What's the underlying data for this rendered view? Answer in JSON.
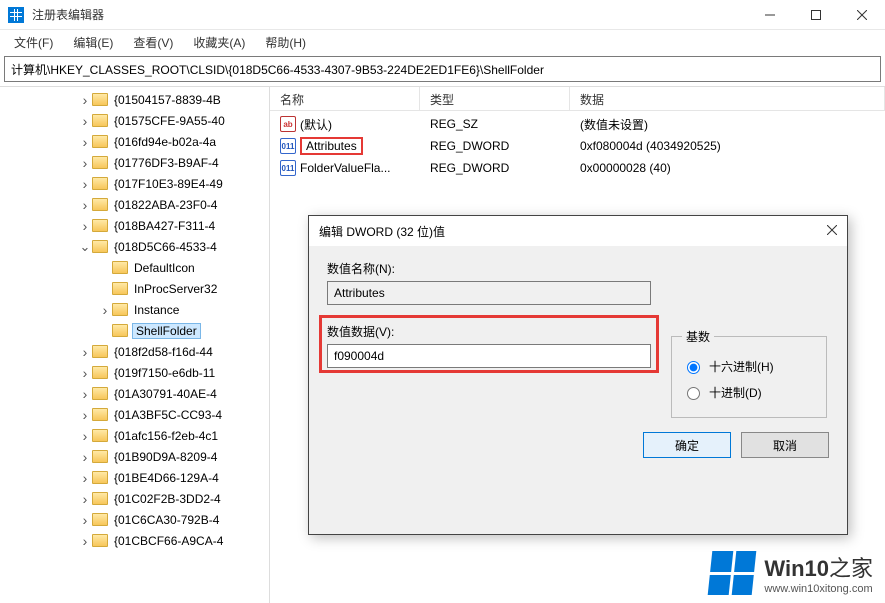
{
  "window": {
    "title": "注册表编辑器"
  },
  "menu": {
    "file": "文件(F)",
    "edit": "编辑(E)",
    "view": "查看(V)",
    "favorites": "收藏夹(A)",
    "help": "帮助(H)"
  },
  "address": "计算机\\HKEY_CLASSES_ROOT\\CLSID\\{018D5C66-4533-4307-9B53-224DE2ED1FE6}\\ShellFolder",
  "tree": {
    "items": [
      {
        "indent": 78,
        "chev": "closed",
        "label": "{01504157-8839-4B"
      },
      {
        "indent": 78,
        "chev": "closed",
        "label": "{01575CFE-9A55-40"
      },
      {
        "indent": 78,
        "chev": "closed",
        "label": "{016fd94e-b02a-4a"
      },
      {
        "indent": 78,
        "chev": "closed",
        "label": "{01776DF3-B9AF-4"
      },
      {
        "indent": 78,
        "chev": "closed",
        "label": "{017F10E3-89E4-49"
      },
      {
        "indent": 78,
        "chev": "closed",
        "label": "{01822ABA-23F0-4"
      },
      {
        "indent": 78,
        "chev": "closed",
        "label": "{018BA427-F311-4"
      },
      {
        "indent": 78,
        "chev": "open",
        "label": "{018D5C66-4533-4"
      },
      {
        "indent": 98,
        "chev": "none",
        "label": "DefaultIcon"
      },
      {
        "indent": 98,
        "chev": "none",
        "label": "InProcServer32"
      },
      {
        "indent": 98,
        "chev": "closed",
        "label": "Instance"
      },
      {
        "indent": 98,
        "chev": "none",
        "label": "ShellFolder",
        "selected": true
      },
      {
        "indent": 78,
        "chev": "closed",
        "label": "{018f2d58-f16d-44"
      },
      {
        "indent": 78,
        "chev": "closed",
        "label": "{019f7150-e6db-11"
      },
      {
        "indent": 78,
        "chev": "closed",
        "label": "{01A30791-40AE-4"
      },
      {
        "indent": 78,
        "chev": "closed",
        "label": "{01A3BF5C-CC93-4"
      },
      {
        "indent": 78,
        "chev": "closed",
        "label": "{01afc156-f2eb-4c1"
      },
      {
        "indent": 78,
        "chev": "closed",
        "label": "{01B90D9A-8209-4"
      },
      {
        "indent": 78,
        "chev": "closed",
        "label": "{01BE4D66-129A-4"
      },
      {
        "indent": 78,
        "chev": "closed",
        "label": "{01C02F2B-3DD2-4"
      },
      {
        "indent": 78,
        "chev": "closed",
        "label": "{01C6CA30-792B-4"
      },
      {
        "indent": 78,
        "chev": "closed",
        "label": "{01CBCF66-A9CA-4"
      }
    ]
  },
  "columns": {
    "name": "名称",
    "type": "类型",
    "data": "数据"
  },
  "rows": [
    {
      "icon": "sz",
      "name": "(默认)",
      "type": "REG_SZ",
      "data": "(数值未设置)"
    },
    {
      "icon": "dw",
      "name": "Attributes",
      "type": "REG_DWORD",
      "data": "0xf080004d (4034920525)",
      "hl": true
    },
    {
      "icon": "dw",
      "name": "FolderValueFla...",
      "type": "REG_DWORD",
      "data": "0x00000028 (40)"
    }
  ],
  "dialog": {
    "title": "编辑 DWORD (32 位)值",
    "name_label": "数值名称(N):",
    "name_value": "Attributes",
    "data_label": "数值数据(V):",
    "data_value": "f090004d",
    "base_label": "基数",
    "hex_label": "十六进制(H)",
    "dec_label": "十进制(D)",
    "ok": "确定",
    "cancel": "取消"
  },
  "watermark": {
    "brand_a": "Win10",
    "brand_b": "之家",
    "url": "www.win10xitong.com"
  }
}
